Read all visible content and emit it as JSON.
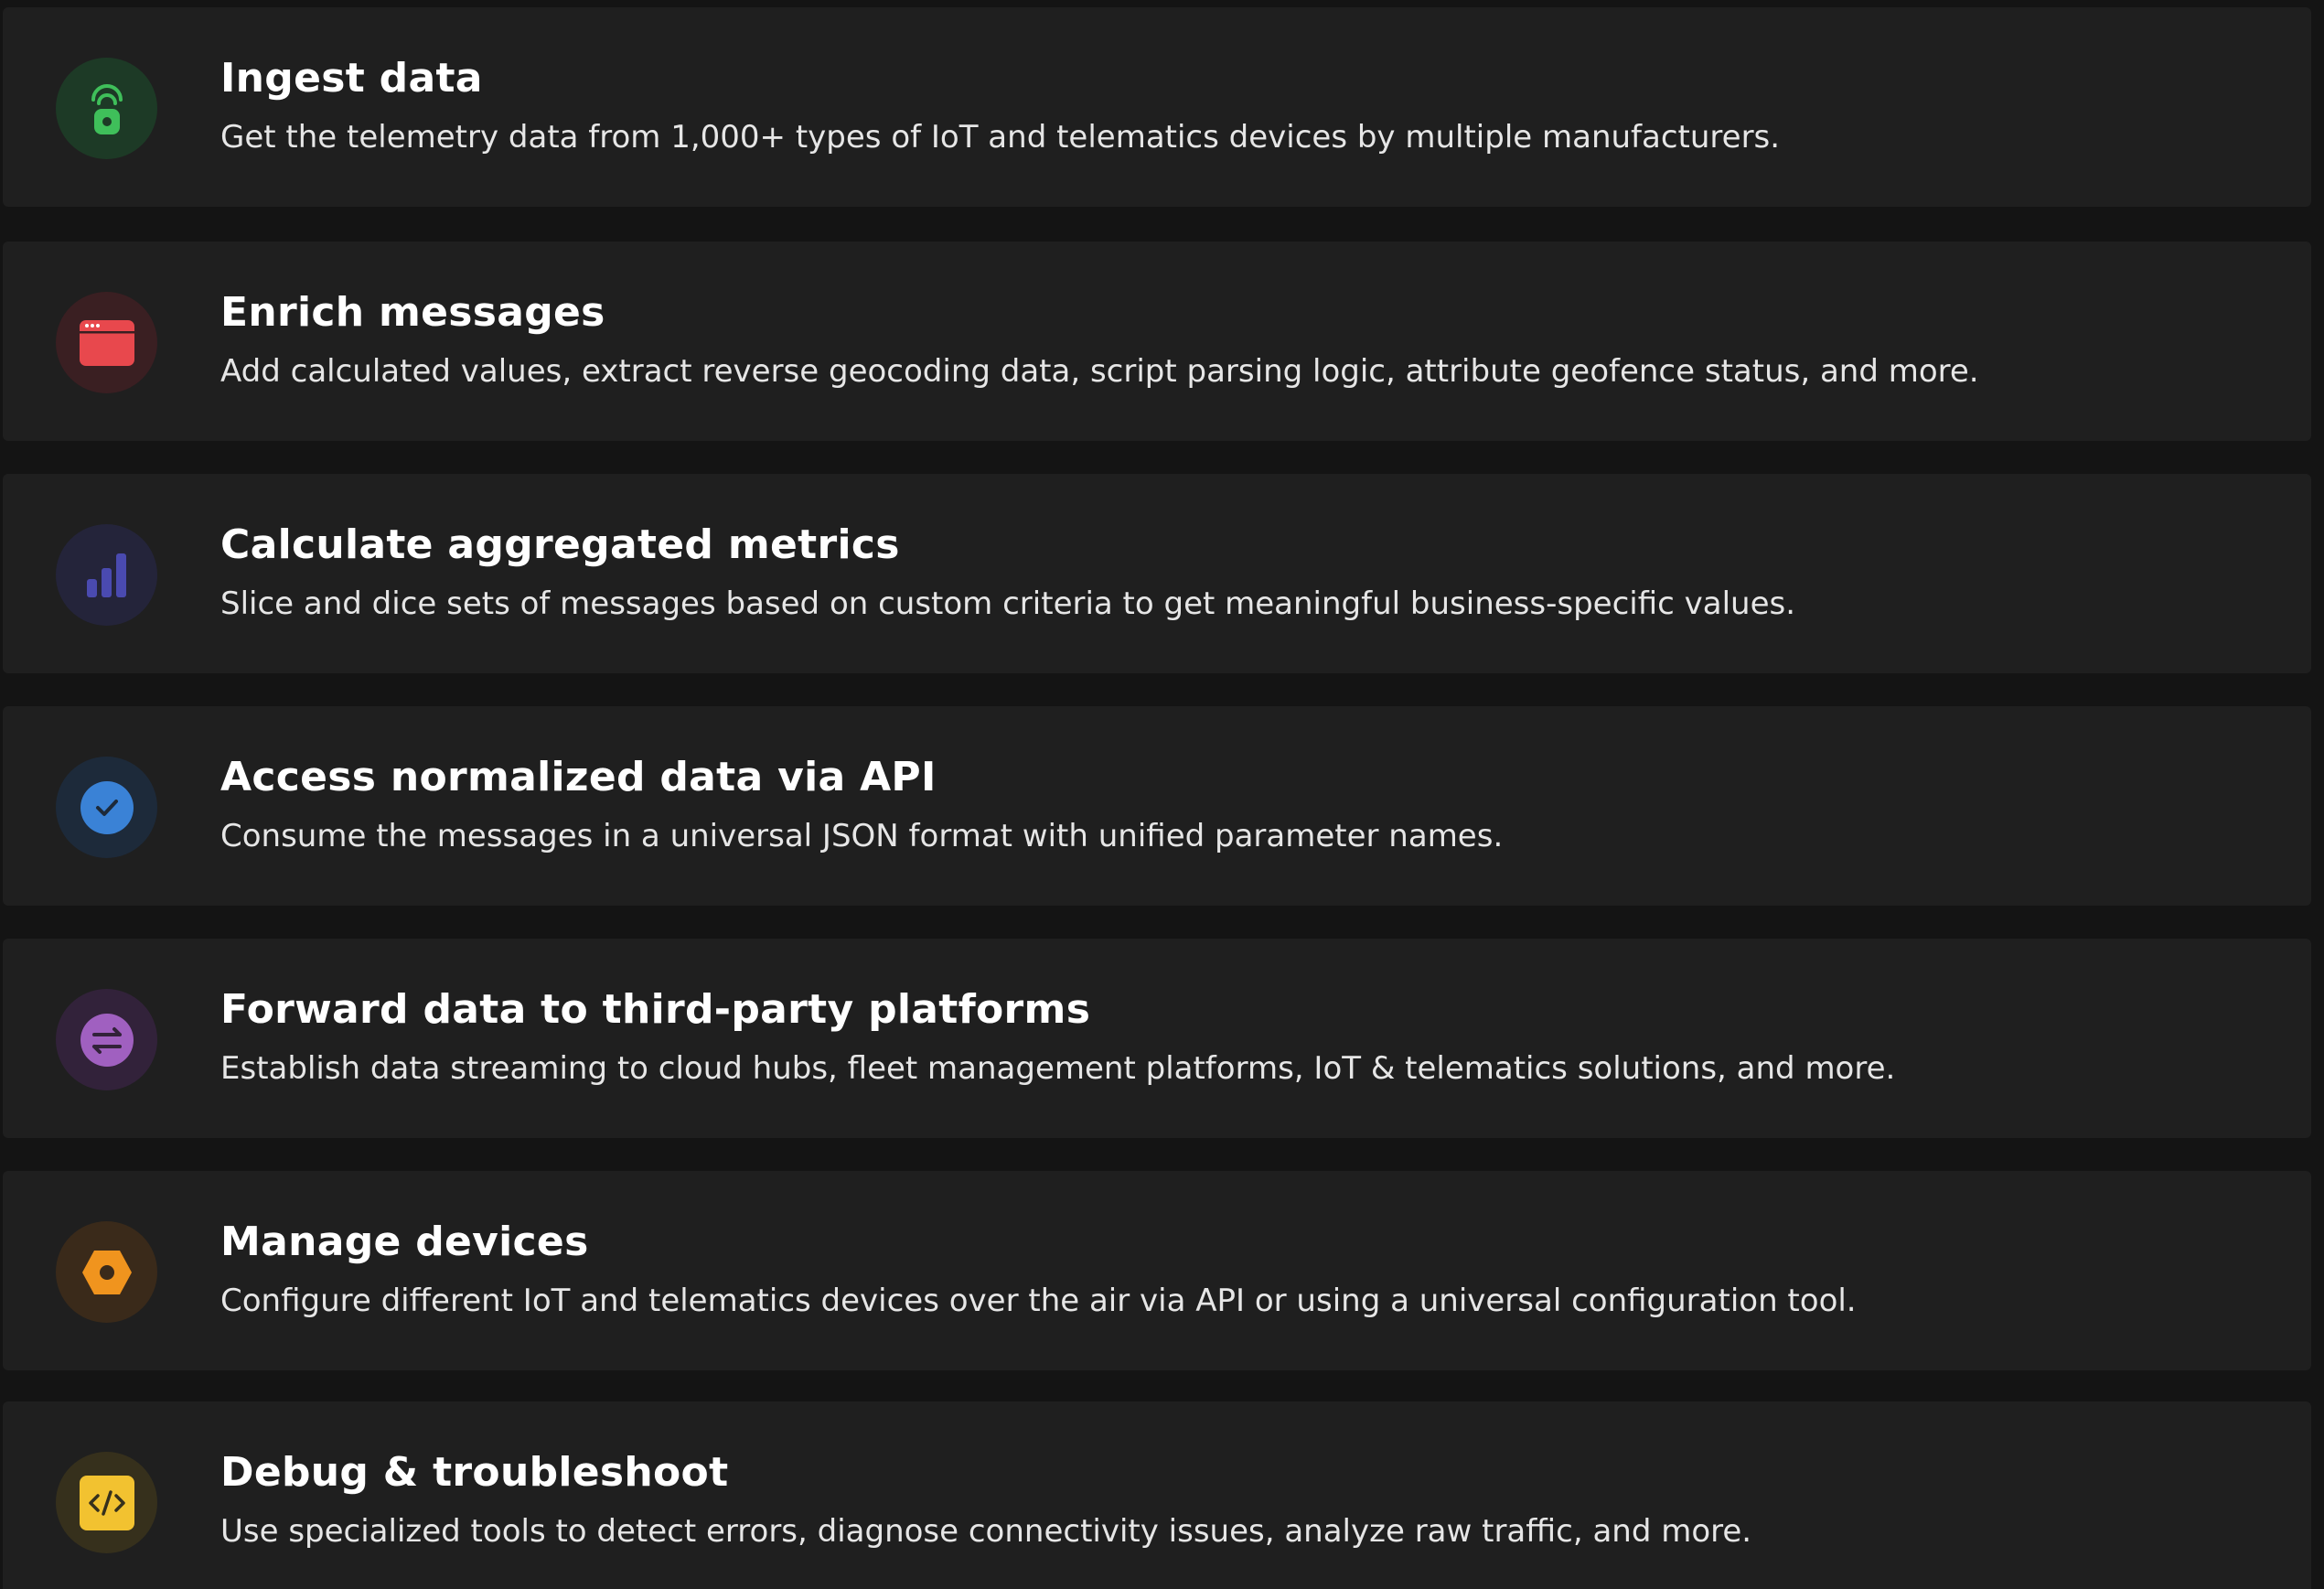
{
  "features": [
    {
      "title": "Ingest data",
      "description": "Get the telemetry data from 1,000+ types of IoT and telematics devices by multiple manufacturers.",
      "icon": "ingest-icon",
      "accent": "#3fbf5a",
      "icon_bg": "#1d3a26"
    },
    {
      "title": "Enrich messages",
      "description": "Add calculated values, extract reverse geocoding data, script parsing logic, attribute geofence status, and more.",
      "icon": "browser-window-icon",
      "accent": "#e8484d",
      "icon_bg": "#3a1f22"
    },
    {
      "title": "Calculate aggregated metrics",
      "description": "Slice and dice sets of messages based on custom criteria to get meaningful business-specific values.",
      "icon": "bar-chart-icon",
      "accent": "#4a4ab0",
      "icon_bg": "#24243a"
    },
    {
      "title": "Access normalized data via API",
      "description": "Consume the messages in a universal JSON format with unified parameter names.",
      "icon": "checkmark-icon",
      "accent": "#3a82d6",
      "icon_bg": "#1d2a3a"
    },
    {
      "title": "Forward data to third-party platforms",
      "description": "Establish data streaming to cloud hubs, fleet management platforms, IoT & telematics solutions, and more.",
      "icon": "swap-arrows-icon",
      "accent": "#a060c0",
      "icon_bg": "#32223a"
    },
    {
      "title": "Manage devices",
      "description": "Configure different IoT and telematics devices over the air via API or using a universal configuration tool.",
      "icon": "hex-nut-icon",
      "accent": "#f0941e",
      "icon_bg": "#3a2a1a"
    },
    {
      "title": "Debug & troubleshoot",
      "description": "Use specialized tools to detect errors, diagnose connectivity issues, analyze raw traffic, and more.",
      "icon": "code-icon",
      "accent": "#f2c230",
      "icon_bg": "#36301c"
    }
  ]
}
